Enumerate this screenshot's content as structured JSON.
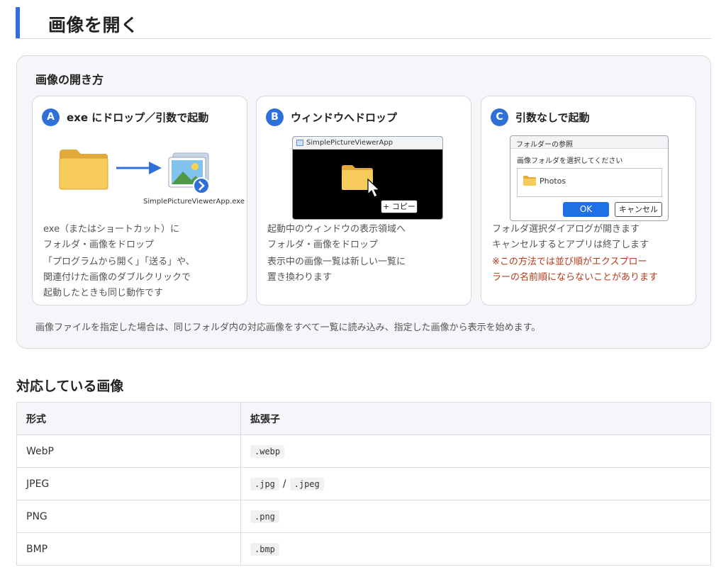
{
  "header": {
    "title": "画像を開く"
  },
  "panel": {
    "title": "画像の開き方",
    "cards": [
      {
        "badge": "A",
        "title": "exe にドロップ／引数で起動",
        "illustration": {
          "exe_name": "SimplePictureViewerApp.exe"
        },
        "lines": [
          "exe（またはショートカット）に",
          "フォルダ・画像をドロップ",
          "「プログラムから開く」「送る」や、",
          "関連付けた画像のダブルクリックで",
          "起動したときも同じ動作です"
        ]
      },
      {
        "badge": "B",
        "title": "ウィンドウへドロップ",
        "illustration": {
          "window_title": "SimplePictureViewerApp",
          "copy_label": "+ コピー"
        },
        "lines": [
          "起動中のウィンドウの表示領域へ",
          "フォルダ・画像をドロップ",
          "表示中の画像一覧は新しい一覧に",
          "置き換わります"
        ]
      },
      {
        "badge": "C",
        "title": "引数なしで起動",
        "illustration": {
          "dialog_title": "フォルダーの参照",
          "dialog_message": "画像フォルダを選択してください",
          "folder_item": "Photos",
          "ok_label": "OK",
          "cancel_label": "キャンセル"
        },
        "lines": [
          "フォルダ選択ダイアログが開きます",
          "キャンセルするとアプリは終了します"
        ],
        "note_lines": [
          "※この方法では並び順がエクスプロー",
          "ラーの名前順にならないことがあります"
        ]
      }
    ],
    "footer": "画像ファイルを指定した場合は、同じフォルダ内の対応画像をすべて一覧に読み込み、指定した画像から表示を始めます。"
  },
  "supported": {
    "title": "対応している画像",
    "columns": [
      "形式",
      "拡張子"
    ],
    "rows": [
      {
        "format": "WebP",
        "exts": [
          ".webp"
        ]
      },
      {
        "format": "JPEG",
        "exts": [
          ".jpg",
          ".jpeg"
        ],
        "separator": "/"
      },
      {
        "format": "PNG",
        "exts": [
          ".png"
        ]
      },
      {
        "format": "BMP",
        "exts": [
          ".bmp"
        ]
      }
    ]
  },
  "colors": {
    "accent": "#2f6fd8",
    "note": "#b3391b",
    "folder": "#f5c852",
    "ok_button": "#1f6fe5"
  }
}
